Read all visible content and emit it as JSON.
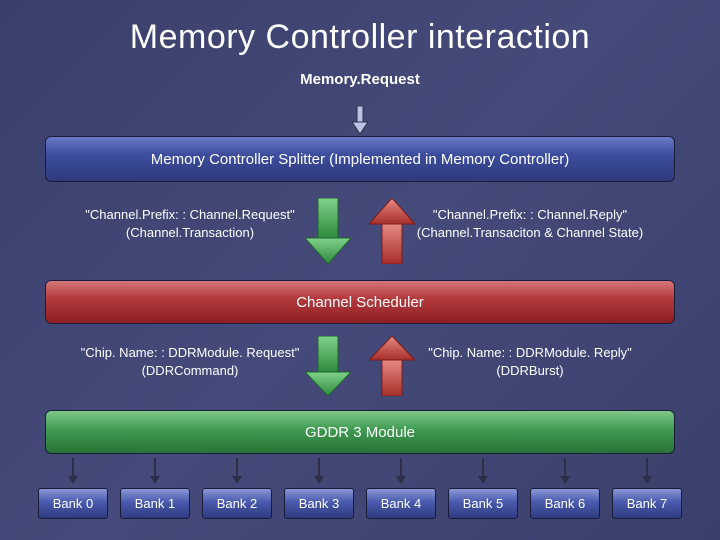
{
  "title": "Memory Controller interaction",
  "top_label": "Memory.Request",
  "splitter": "Memory Controller Splitter (Implemented in Memory Controller)",
  "row1": {
    "left_line1": "\"Channel.Prefix: : Channel.Request\"",
    "left_line2": "(Channel.Transaction)",
    "right_line1": "\"Channel.Prefix: : Channel.Reply\"",
    "right_line2": "(Channel.Transaciton & Channel State)"
  },
  "scheduler": "Channel Scheduler",
  "row2": {
    "left_line1": "\"Chip. Name: : DDRModule. Request\"",
    "left_line2": "(DDRCommand)",
    "right_line1": "\"Chip. Name: : DDRModule. Reply\"",
    "right_line2": "(DDRBurst)"
  },
  "module": "GDDR 3 Module",
  "banks": [
    "Bank 0",
    "Bank 1",
    "Bank 2",
    "Bank 3",
    "Bank 4",
    "Bank 5",
    "Bank 6",
    "Bank 7"
  ],
  "colors": {
    "arrow_down_green": "#4aa84f",
    "arrow_up_red": "#cf3c33",
    "arrow_small": "#b9c2e6",
    "arrow_bank": "#2c2f45"
  }
}
